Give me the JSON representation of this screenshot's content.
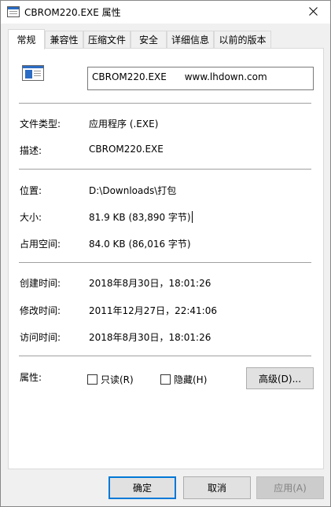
{
  "window": {
    "title": "CBROM220.EXE 属性"
  },
  "tabs": [
    {
      "label": "常规"
    },
    {
      "label": "兼容性"
    },
    {
      "label": "压缩文件"
    },
    {
      "label": "安全"
    },
    {
      "label": "详细信息"
    },
    {
      "label": "以前的版本"
    }
  ],
  "general": {
    "file_name": "CBROM220.EXE      www.lhdown.com",
    "file_type_label": "文件类型:",
    "file_type_value": "应用程序 (.EXE)",
    "description_label": "描述:",
    "description_value": "CBROM220.EXE",
    "location_label": "位置:",
    "location_value": "D:\\Downloads\\打包",
    "size_label": "大小:",
    "size_value": "81.9 KB (83,890 字节)",
    "size_on_disk_label": "占用空间:",
    "size_on_disk_value": "84.0 KB (86,016 字节)",
    "created_label": "创建时间:",
    "created_value": "2018年8月30日，18:01:26",
    "modified_label": "修改时间:",
    "modified_value": "2011年12月27日，22:41:06",
    "accessed_label": "访问时间:",
    "accessed_value": "2018年8月30日，18:01:26",
    "attributes_label": "属性:",
    "readonly_label": "只读(R)",
    "readonly_checked": false,
    "hidden_label": "隐藏(H)",
    "hidden_checked": false,
    "advanced_label": "高级(D)..."
  },
  "footer": {
    "ok_label": "确定",
    "cancel_label": "取消",
    "apply_label": "应用(A)"
  },
  "colors": {
    "accent": "#0078d7",
    "panel_bg": "#ffffff",
    "window_bg": "#f0f0f0"
  }
}
